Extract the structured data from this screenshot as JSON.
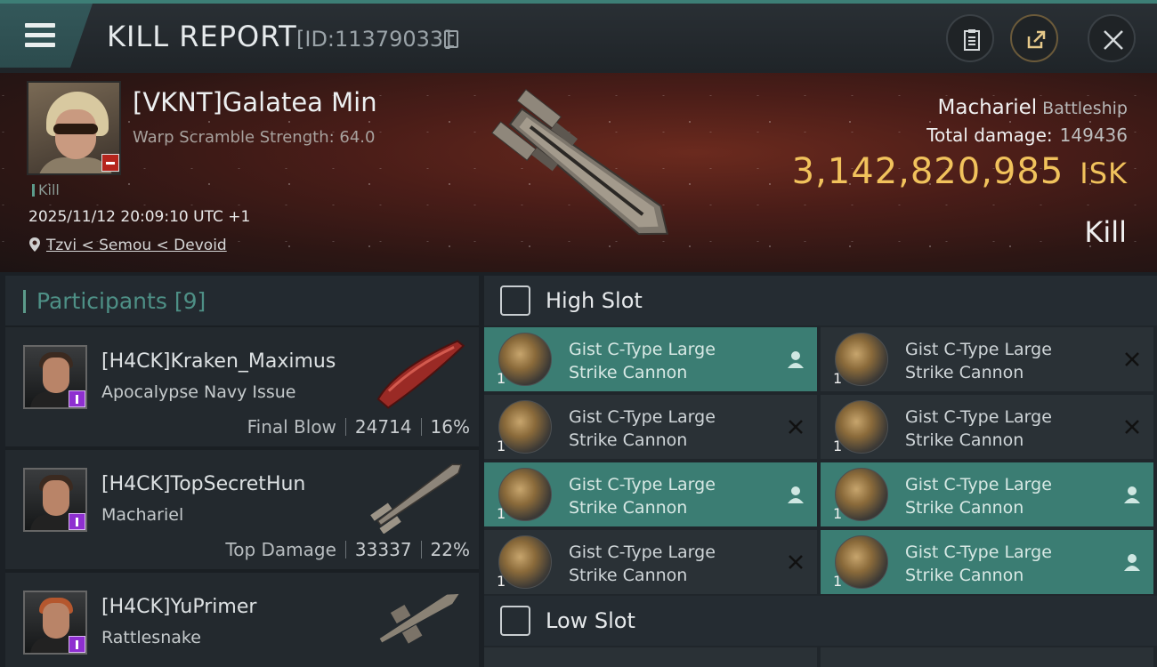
{
  "header": {
    "title": "KILL REPORT",
    "id_text": "[ID:11379033]"
  },
  "victim": {
    "name": "[VKNT]Galatea Min",
    "warp_scramble": "Warp Scramble Strength: 64.0",
    "kill_tag": "Kill",
    "datetime": "2025/11/12 20:09:10 UTC +1",
    "location": "Tzvi < Semou < Devoid",
    "ship_name": "Machariel",
    "ship_class": "Battleship",
    "total_damage_label": "Total damage:",
    "total_damage": "149436",
    "isk_value": "3,142,820,985",
    "isk_unit": "ISK",
    "result": "Kill"
  },
  "participants": {
    "label": "Participants",
    "count": "[9]",
    "rows": [
      {
        "name": "[H4CK]Kraken_Maximus",
        "ship": "Apocalypse Navy Issue",
        "role": "Final Blow",
        "damage": "24714",
        "percent": "16%"
      },
      {
        "name": "[H4CK]TopSecretHun",
        "ship": "Machariel",
        "role": "Top Damage",
        "damage": "33337",
        "percent": "22%"
      },
      {
        "name": "[H4CK]YuPrimer",
        "ship": "Rattlesnake"
      }
    ]
  },
  "high_slot": {
    "label": "High Slot",
    "modules": [
      {
        "line1": "Gist C-Type Large",
        "line2": "Strike Cannon",
        "qty": "1",
        "state": "dropped"
      },
      {
        "line1": "Gist C-Type Large",
        "line2": "Strike Cannon",
        "qty": "1",
        "state": "destroyed"
      },
      {
        "line1": "Gist C-Type Large",
        "line2": "Strike Cannon",
        "qty": "1",
        "state": "destroyed"
      },
      {
        "line1": "Gist C-Type Large",
        "line2": "Strike Cannon",
        "qty": "1",
        "state": "destroyed"
      },
      {
        "line1": "Gist C-Type Large",
        "line2": "Strike Cannon",
        "qty": "1",
        "state": "dropped"
      },
      {
        "line1": "Gist C-Type Large",
        "line2": "Strike Cannon",
        "qty": "1",
        "state": "dropped"
      },
      {
        "line1": "Gist C-Type Large",
        "line2": "Strike Cannon",
        "qty": "1",
        "state": "destroyed"
      },
      {
        "line1": "Gist C-Type Large",
        "line2": "Strike Cannon",
        "qty": "1",
        "state": "dropped"
      }
    ]
  },
  "low_slot": {
    "label": "Low Slot"
  },
  "colors": {
    "accent": "#3b7d73",
    "isk": "#f1c25c",
    "badge_red": "#b5251d",
    "badge_purple": "#8e2fd0"
  }
}
